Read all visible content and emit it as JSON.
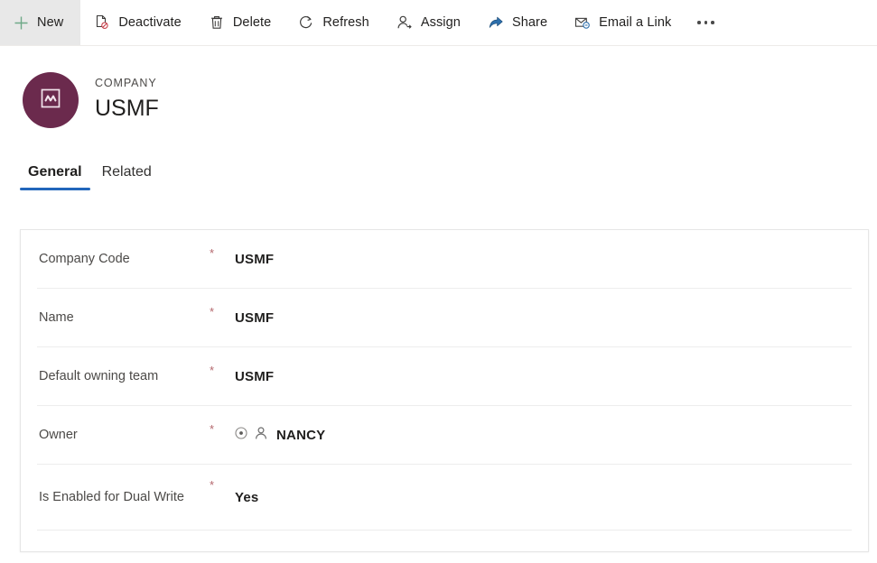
{
  "command_bar": {
    "buttons": [
      {
        "label": "New",
        "icon": "plus-icon",
        "name": "new-button",
        "state": "hover"
      },
      {
        "label": "Deactivate",
        "icon": "deactivate-icon",
        "name": "deactivate-button",
        "state": "normal"
      },
      {
        "label": "Delete",
        "icon": "trash-icon",
        "name": "delete-button",
        "state": "normal"
      },
      {
        "label": "Refresh",
        "icon": "refresh-icon",
        "name": "refresh-button",
        "state": "normal"
      },
      {
        "label": "Assign",
        "icon": "assign-user-icon",
        "name": "assign-button",
        "state": "normal"
      },
      {
        "label": "Share",
        "icon": "share-icon",
        "name": "share-button",
        "state": "normal"
      },
      {
        "label": "Email a Link",
        "icon": "email-link-icon",
        "name": "email-a-link-button",
        "state": "normal"
      }
    ],
    "overflow_label": "..."
  },
  "record_header": {
    "entity_type": "COMPANY",
    "record_name": "USMF",
    "avatar_icon": "company-entity-icon",
    "avatar_color": "#6b2a4d"
  },
  "tabs": [
    {
      "label": "General",
      "name": "tab-general",
      "active": true
    },
    {
      "label": "Related",
      "name": "tab-related",
      "active": false
    }
  ],
  "tab_accent_color": "#2266bb",
  "form": {
    "required_marker": "*",
    "rows": [
      {
        "label": "Company Code",
        "value": "USMF",
        "required": true,
        "name": "field-company-code",
        "type": "text"
      },
      {
        "label": "Name",
        "value": "USMF",
        "required": true,
        "name": "field-name",
        "type": "text"
      },
      {
        "label": "Default owning team",
        "value": "USMF",
        "required": true,
        "name": "field-default-owning-team",
        "type": "text"
      },
      {
        "label": "Owner",
        "value": "NANCY",
        "required": true,
        "name": "field-owner",
        "type": "lookup",
        "icons": [
          "record-status-icon",
          "person-icon"
        ]
      },
      {
        "label": "Is Enabled for Dual Write",
        "value": "Yes",
        "required": true,
        "name": "field-is-enabled-for-dual-write",
        "type": "choice"
      }
    ]
  }
}
